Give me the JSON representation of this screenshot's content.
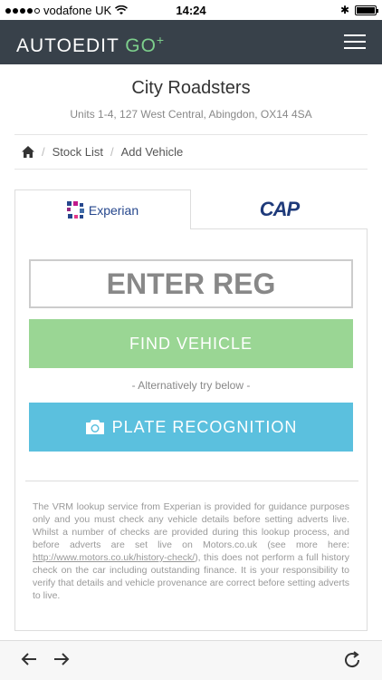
{
  "status_bar": {
    "carrier": "vodafone UK",
    "time": "14:24"
  },
  "navbar": {
    "brand_main": "AUTOEDIT ",
    "brand_go": "GO",
    "brand_plus": "+"
  },
  "dealer": {
    "name": "City Roadsters",
    "address": "Units 1-4, 127 West Central, Abingdon, OX14 4SA"
  },
  "breadcrumb": {
    "items": [
      "Stock List",
      "Add Vehicle"
    ]
  },
  "tabs": {
    "experian_label": "Experian",
    "cap_label": "CAP"
  },
  "lookup": {
    "reg_placeholder": "ENTER REG",
    "find_button": "FIND VEHICLE",
    "alternative_text": "- Alternatively try below -",
    "plate_button": "PLATE RECOGNITION"
  },
  "disclaimer": {
    "part1": "The VRM lookup service from Experian is provided for guidance purposes only and you must check any vehicle details before setting adverts live. Whilst a number of checks are provided during this lookup process, and before adverts are set live on Motors.co.uk (see more here: ",
    "link": "http://www.motors.co.uk/history-check/",
    "part2": "), this does not perform a full history check on the car including outstanding finance. It is your responsibility to verify that details and vehicle provenance are correct before setting adverts to live."
  },
  "colors": {
    "navbar": "#38414a",
    "find_button": "#9ad694",
    "plate_button": "#5bc0de"
  }
}
